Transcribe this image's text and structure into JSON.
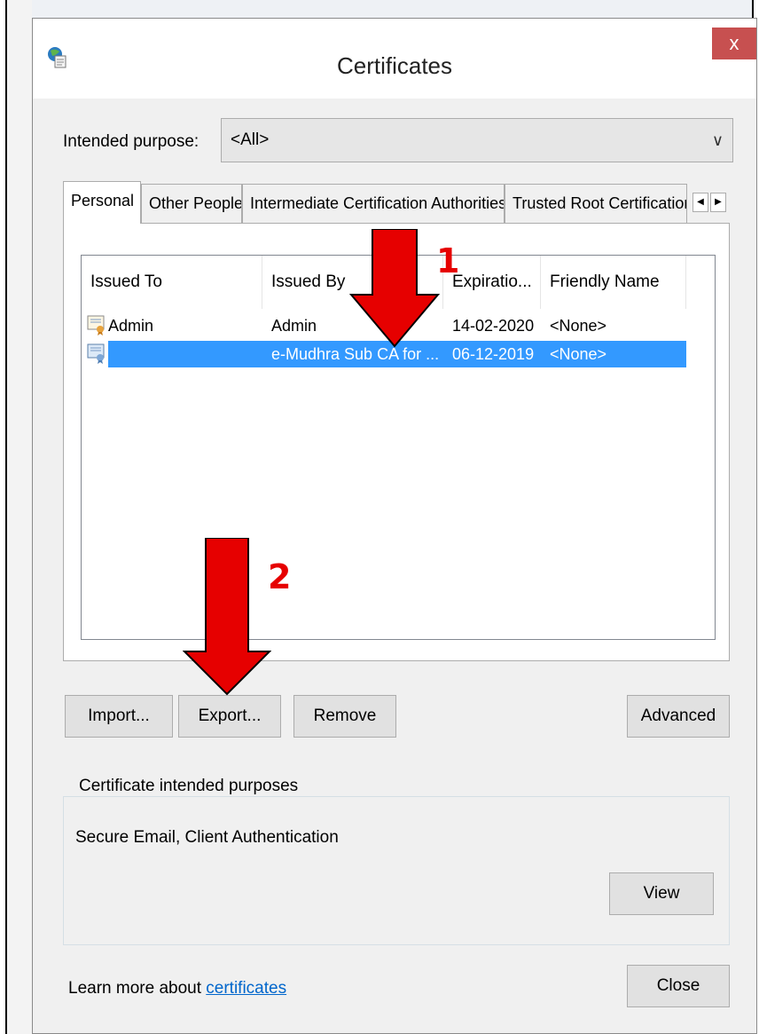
{
  "dialog": {
    "title": "Certificates",
    "close_label": "x"
  },
  "purpose": {
    "label": "Intended purpose:",
    "value": "<All>"
  },
  "tabs": [
    {
      "label": "Personal",
      "active": true
    },
    {
      "label": "Other People",
      "active": false
    },
    {
      "label": "Intermediate Certification Authorities",
      "active": false
    },
    {
      "label": "Trusted Root Certification",
      "active": false
    }
  ],
  "list": {
    "columns": [
      "Issued To",
      "Issued By",
      "Expiratio...",
      "Friendly Name"
    ],
    "rows": [
      {
        "issued_to": "Admin",
        "issued_by": "Admin",
        "expiration": "14-02-2020",
        "friendly_name": "<None>",
        "selected": false
      },
      {
        "issued_to": "",
        "issued_by": "e-Mudhra Sub CA for ...",
        "expiration": "06-12-2019",
        "friendly_name": "<None>",
        "selected": true
      }
    ]
  },
  "buttons": {
    "import": "Import...",
    "export": "Export...",
    "remove": "Remove",
    "advanced": "Advanced",
    "view": "View",
    "close": "Close"
  },
  "purposes_group": {
    "legend": "Certificate intended purposes",
    "text": "Secure Email, Client Authentication"
  },
  "footer": {
    "learn_prefix": "Learn more about ",
    "learn_link": "certificates"
  },
  "annotations": {
    "step1": "1",
    "step2": "2",
    "arrow_color": "#e60000"
  },
  "colors": {
    "selection": "#3399ff",
    "close_button": "#c75050",
    "link": "#0066cc"
  }
}
